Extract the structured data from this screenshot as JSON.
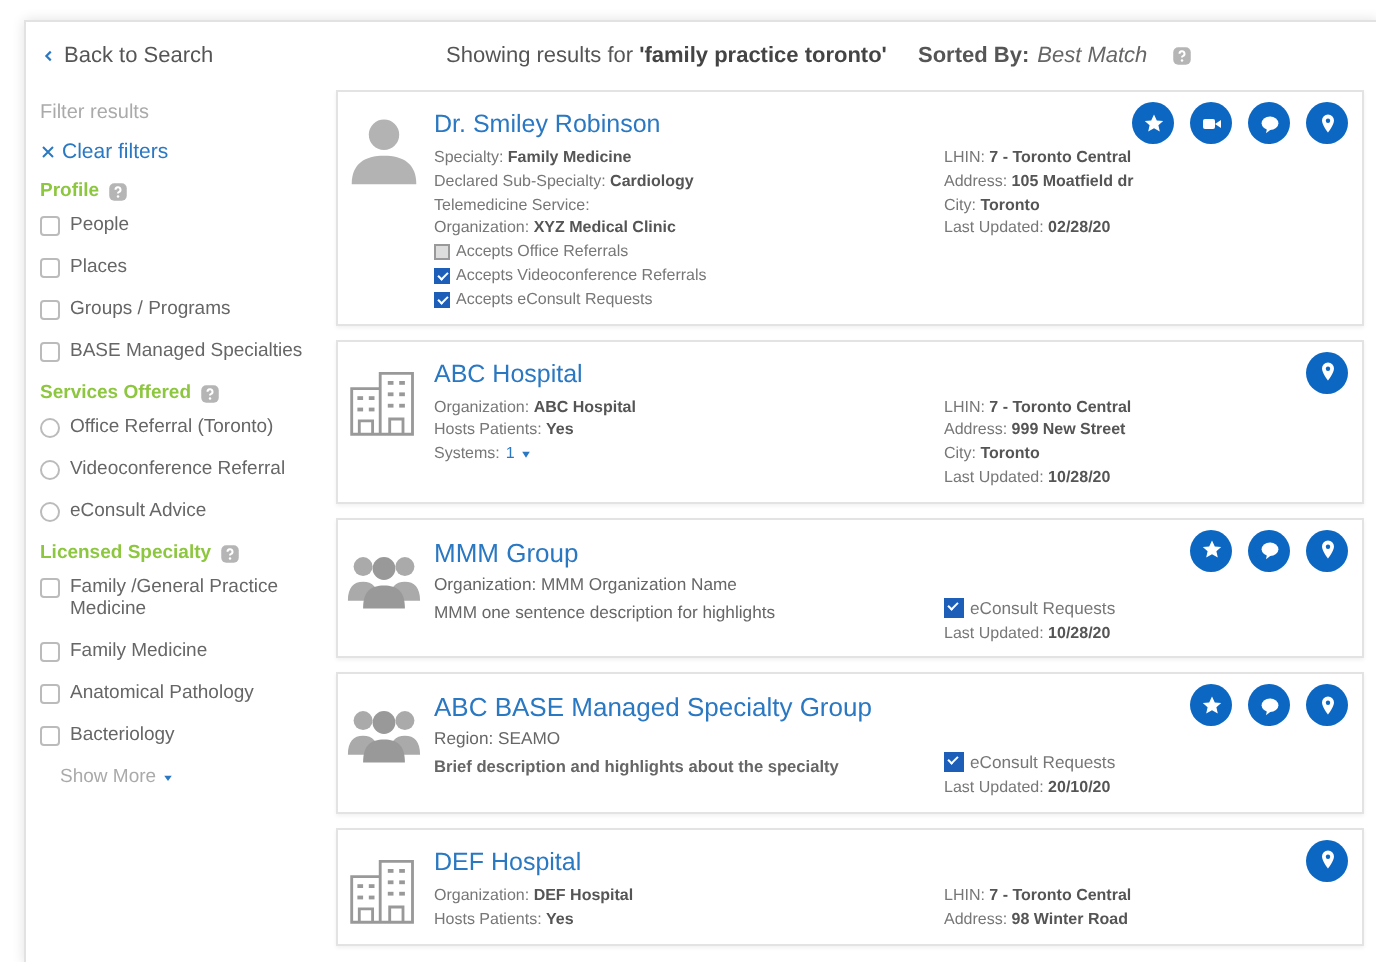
{
  "header": {
    "back_link": "Back to Search",
    "query": "Showing results for **'family practice toronto'**",
    "sort_label": "Sorted By:",
    "sort_value": "Best Match"
  },
  "sidebar": {
    "title": "Filter results",
    "clear_filters": "Clear filters",
    "groups": [
      {
        "title": "Profile",
        "items": [
          {
            "kind": "checkbox",
            "label": "People",
            "checked": false
          },
          {
            "kind": "checkbox",
            "label": "Places",
            "checked": false
          },
          {
            "kind": "checkbox",
            "label": "Groups / Programs",
            "checked": false
          },
          {
            "kind": "checkbox",
            "label": "BASE Managed Specialties",
            "checked": false
          }
        ]
      },
      {
        "title": "Services Offered",
        "items": [
          {
            "kind": "radio",
            "label": "Office Referral (Toronto)",
            "checked": false
          },
          {
            "kind": "radio",
            "label": "Videoconference Referral",
            "checked": false
          },
          {
            "kind": "radio",
            "label": "eConsult Advice",
            "checked": false
          }
        ]
      },
      {
        "title": "Licensed Specialty",
        "items": [
          {
            "kind": "checkbox",
            "label": "Family /General Practice Medicine",
            "checked": false
          },
          {
            "kind": "checkbox",
            "label": "Family Medicine",
            "checked": false
          },
          {
            "kind": "checkbox",
            "label": "Anatomical Pathology",
            "checked": false
          },
          {
            "kind": "checkbox",
            "label": "Bacteriology",
            "checked": false
          }
        ]
      }
    ],
    "show_more": "Show More"
  },
  "results": [
    {
      "kind": "person",
      "name": "Dr. Smiley Robinson",
      "actions": [
        {
          "kind": "star"
        },
        {
          "kind": "video"
        },
        {
          "kind": "chat"
        },
        {
          "kind": "location"
        }
      ],
      "left": [
        {
          "kind": "field",
          "label": "Specialty:",
          "value": "Family Medicine"
        },
        {
          "kind": "field",
          "label": "Declared Sub-Specialty:",
          "value": "Cardiology"
        },
        {
          "kind": "field",
          "label": "Telemedicine Service:"
        },
        {
          "kind": "field",
          "label": "Organization:",
          "value": "XYZ Medical Clinic"
        },
        {
          "kind": "check",
          "label": "Accepts Office Referrals",
          "checked": false
        },
        {
          "kind": "check",
          "label": "Accepts Videoconference Referrals",
          "checked": true
        },
        {
          "kind": "check",
          "label": "Accepts eConsult Requests",
          "checked": true
        }
      ],
      "right": [
        {
          "kind": "field",
          "label": "LHIN:",
          "value": "7 - Toronto Central"
        },
        {
          "kind": "field",
          "label": "Address:",
          "value": "105 Moatfield dr"
        },
        {
          "kind": "field",
          "label": "City:",
          "value": "Toronto"
        },
        {
          "kind": "field",
          "label": "Last Updated:",
          "value": "02/28/20"
        }
      ]
    },
    {
      "kind": "place",
      "name": "ABC Hospital",
      "actions": [
        {
          "kind": "location"
        }
      ],
      "left": [
        {
          "kind": "field",
          "label": "Organization:",
          "value": "ABC Hospital"
        },
        {
          "kind": "field",
          "label": "Hosts Patients:",
          "value": "Yes"
        },
        {
          "kind": "link-field",
          "label": "Systems:",
          "value": "1"
        }
      ],
      "right": [
        {
          "kind": "field",
          "label": "LHIN:",
          "value": "7 - Toronto Central"
        },
        {
          "kind": "field",
          "label": "Address:",
          "value": "999 New Street"
        },
        {
          "kind": "field",
          "label": "City:",
          "value": "Toronto"
        },
        {
          "kind": "field",
          "label": "Last Updated:",
          "value": "10/28/20"
        }
      ]
    },
    {
      "kind": "group",
      "name": "MMM Group",
      "actions": [
        {
          "kind": "star"
        },
        {
          "kind": "chat"
        },
        {
          "kind": "location"
        }
      ],
      "left": [
        {
          "kind": "plain-field",
          "label": "Organization:",
          "value": "MMM Organization Name"
        },
        {
          "kind": "description",
          "text": "MMM one sentence description for highlights"
        }
      ],
      "right": [
        {
          "kind": "check",
          "label": "eConsult Requests",
          "checked": true
        },
        {
          "kind": "field",
          "label": "Last Updated:",
          "value": "10/28/20"
        }
      ]
    },
    {
      "kind": "group",
      "name": "ABC BASE Managed Specialty Group",
      "actions": [
        {
          "kind": "star"
        },
        {
          "kind": "chat"
        },
        {
          "kind": "location"
        }
      ],
      "left": [
        {
          "kind": "plain-field",
          "label": "Region:",
          "value": "SEAMO"
        },
        {
          "kind": "strong-description",
          "text": "Brief description and highlights about the specialty"
        }
      ],
      "right": [
        {
          "kind": "check",
          "label": "eConsult Requests",
          "checked": true
        },
        {
          "kind": "field",
          "label": "Last Updated:",
          "value": "20/10/20"
        }
      ]
    },
    {
      "kind": "place",
      "name": "DEF Hospital",
      "actions": [
        {
          "kind": "location"
        }
      ],
      "left": [
        {
          "kind": "field",
          "label": "Organization:",
          "value": "DEF Hospital"
        },
        {
          "kind": "field",
          "label": "Hosts Patients:",
          "value": "Yes"
        }
      ],
      "right": [
        {
          "kind": "field",
          "label": "LHIN:",
          "value": "7 - Toronto Central"
        },
        {
          "kind": "field",
          "label": "Address:",
          "value": "98 Winter Road"
        }
      ]
    }
  ]
}
